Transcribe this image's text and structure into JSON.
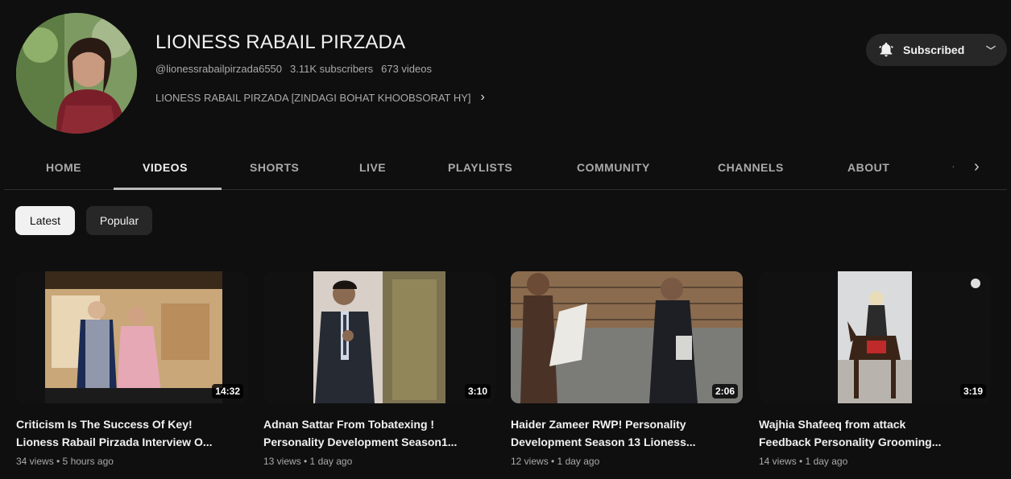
{
  "channel": {
    "name": "LIONESS RABAIL PIRZADA",
    "handle": "@lionessrabailpirzada6550",
    "subscribers": "3.11K subscribers",
    "videos_count": "673 videos",
    "description": "LIONESS RABAIL PIRZADA [ZINDAGI BOHAT KHOOBSORAT HY]",
    "subscribe_label": "Subscribed"
  },
  "tabs": [
    {
      "label": "HOME"
    },
    {
      "label": "VIDEOS"
    },
    {
      "label": "SHORTS"
    },
    {
      "label": "LIVE"
    },
    {
      "label": "PLAYLISTS"
    },
    {
      "label": "COMMUNITY"
    },
    {
      "label": "CHANNELS"
    },
    {
      "label": "ABOUT"
    }
  ],
  "active_tab": "VIDEOS",
  "chips": {
    "latest": "Latest",
    "popular": "Popular"
  },
  "videos": [
    {
      "title_line1": "Criticism Is The Success Of Key!",
      "title_line2": "Lioness Rabail Pirzada Interview O...",
      "duration": "14:32",
      "meta": "34 views • 5 hours ago"
    },
    {
      "title_line1": "Adnan Sattar From Tobatexing !",
      "title_line2": "Personality Development Season1...",
      "duration": "3:10",
      "meta": "13 views • 1 day ago"
    },
    {
      "title_line1": "Haider Zameer RWP! Personality",
      "title_line2": "Development Season 13 Lioness...",
      "duration": "2:06",
      "meta": "12 views • 1 day ago"
    },
    {
      "title_line1": "Wajhia Shafeeq from attack",
      "title_line2": "Feedback Personality Grooming...",
      "duration": "3:19",
      "meta": "14 views • 1 day ago"
    }
  ],
  "colors": {
    "background": "#0f0f0f",
    "chip_active": "#f1f1f1",
    "chip_inactive": "#272727",
    "text_secondary": "#aaaaaa"
  }
}
